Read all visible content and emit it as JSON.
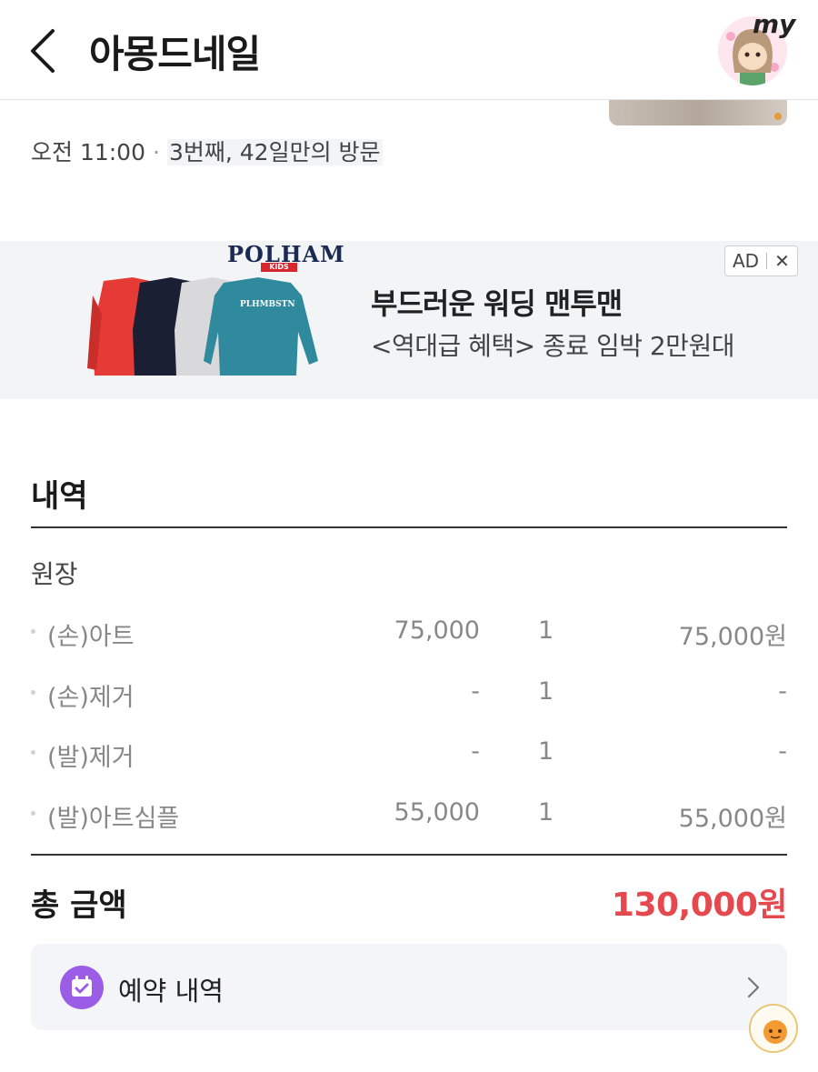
{
  "header": {
    "title": "아몽드네일",
    "my_label": "my"
  },
  "visit": {
    "time": "오전 11:00",
    "separator": "·",
    "count_text": "3번째, 42일만의 방문"
  },
  "ad": {
    "brand": "POLHAM",
    "brand_sub": "KIDS",
    "badge_label": "AD",
    "badge_close": "✕",
    "title": "부드러운 워딩 맨투맨",
    "subtitle": "<역대급 혜택> 종료 임박 2만원대"
  },
  "details": {
    "section_title": "내역",
    "group_label": "원장",
    "items": [
      {
        "name": "(손)아트",
        "price": "75,000",
        "qty": "1",
        "total": "75,000원"
      },
      {
        "name": "(손)제거",
        "price": "-",
        "qty": "1",
        "total": "-"
      },
      {
        "name": "(발)제거",
        "price": "-",
        "qty": "1",
        "total": "-"
      },
      {
        "name": "(발)아트심플",
        "price": "55,000",
        "qty": "1",
        "total": "55,000원"
      }
    ],
    "total_label": "총 금액",
    "total_value": "130,000원"
  },
  "booking": {
    "label": "예약 내역",
    "icon": "calendar-check-icon"
  },
  "colors": {
    "accent_red": "#e5484d",
    "booking_purple": "#9b5de5"
  }
}
